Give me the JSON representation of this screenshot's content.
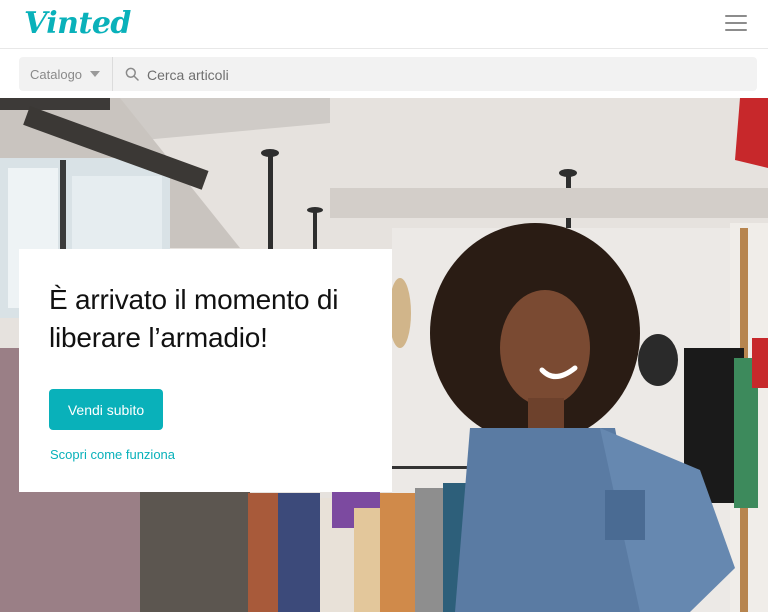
{
  "header": {
    "logo_text": "Vinted",
    "menu_icon": "hamburger-menu-icon",
    "brand_color": "#09b1ba"
  },
  "search": {
    "catalog_label": "Catalogo",
    "placeholder": "Cerca articoli",
    "icon": "search-icon"
  },
  "hero": {
    "title": "È arrivato il momento di liberare l’armadio!",
    "cta_label": "Vendi subito",
    "link_label": "Scopri come funziona"
  }
}
